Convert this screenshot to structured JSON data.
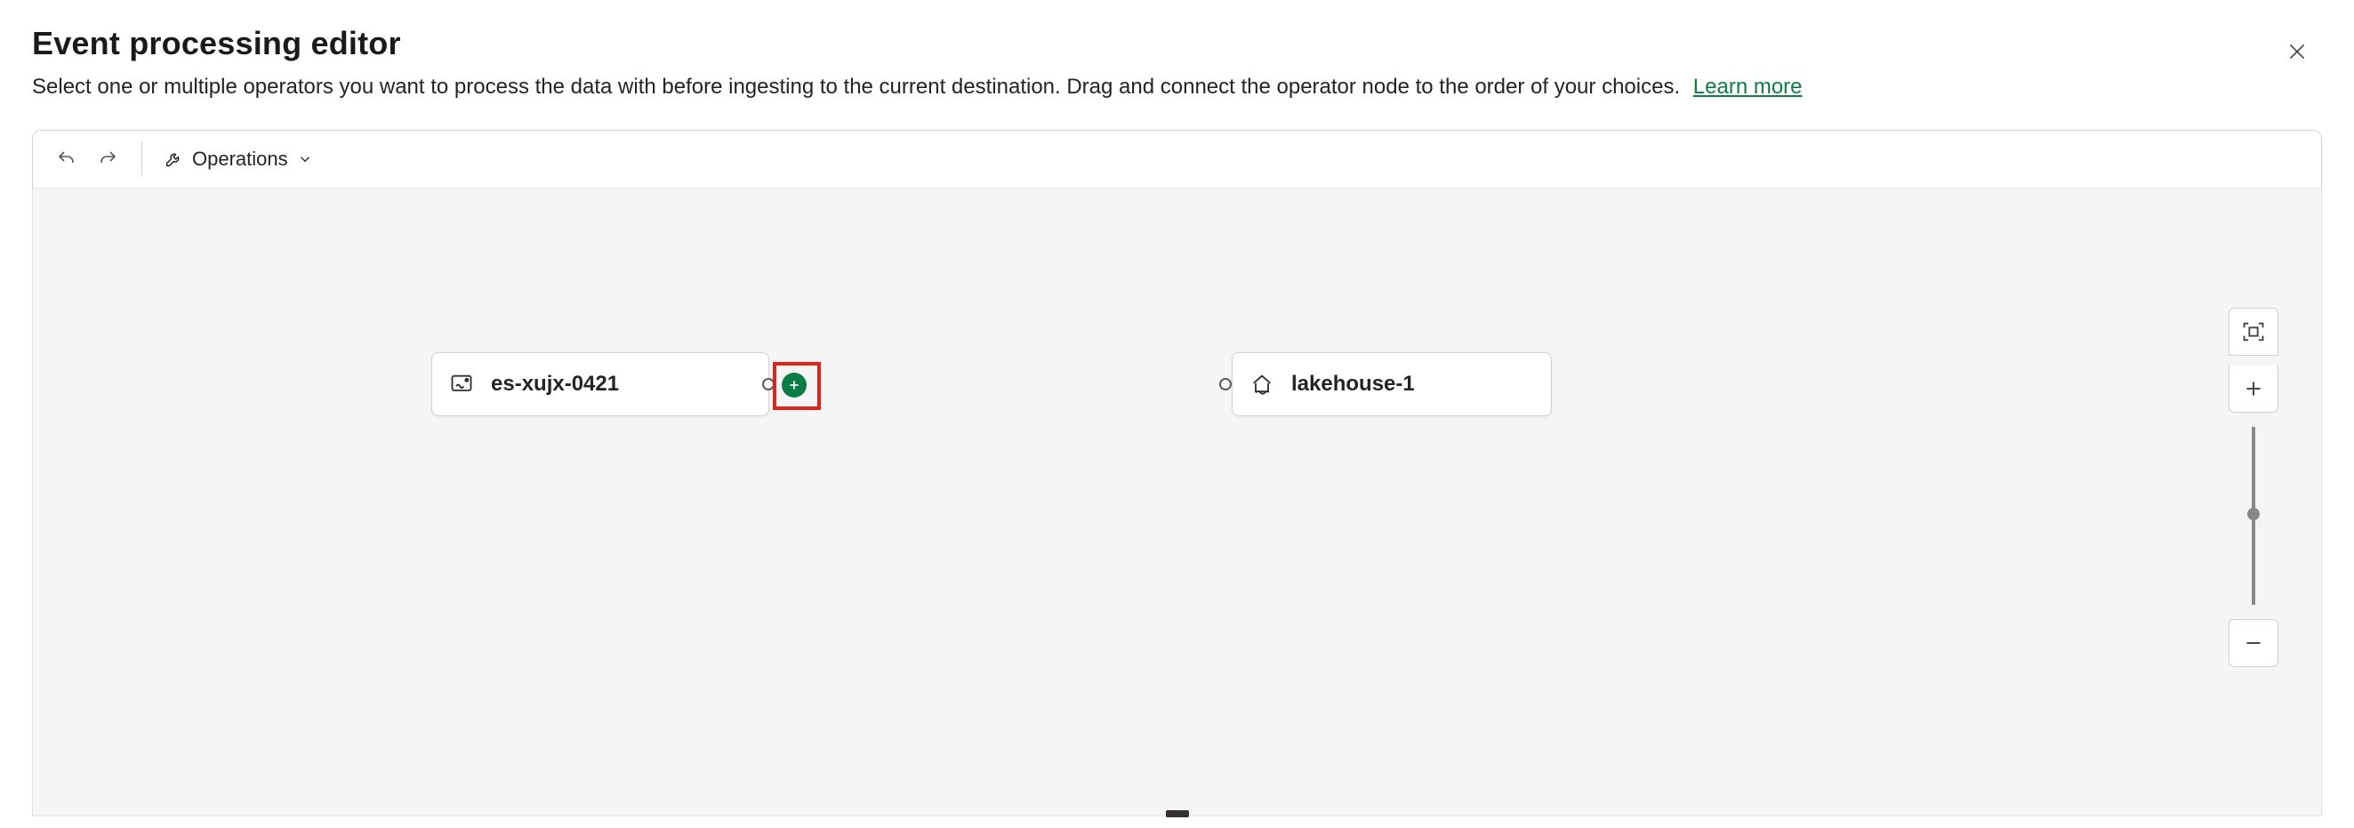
{
  "header": {
    "title": "Event processing editor",
    "subtitle": "Select one or multiple operators you want to process the data with before ingesting to the current destination. Drag and connect the operator node to the order of your choices.",
    "learn_more": "Learn more"
  },
  "toolbar": {
    "operations_label": "Operations",
    "undo_icon": "undo-icon",
    "redo_icon": "redo-icon",
    "ops_icon": "wrench-icon",
    "chevron_icon": "chevron-down-icon"
  },
  "canvas": {
    "nodes": [
      {
        "id": "source",
        "label": "es-xujx-0421",
        "icon": "eventstream-icon"
      },
      {
        "id": "destination",
        "label": "lakehouse-1",
        "icon": "lakehouse-icon"
      }
    ],
    "add_button": {
      "accent": "#0a7d46"
    },
    "highlight": {
      "color": "#e1251b"
    }
  },
  "zoom": {
    "fit_icon": "fit-screen-icon",
    "plus_icon": "plus-icon",
    "minus_icon": "minus-icon"
  },
  "close_icon": "close-icon"
}
